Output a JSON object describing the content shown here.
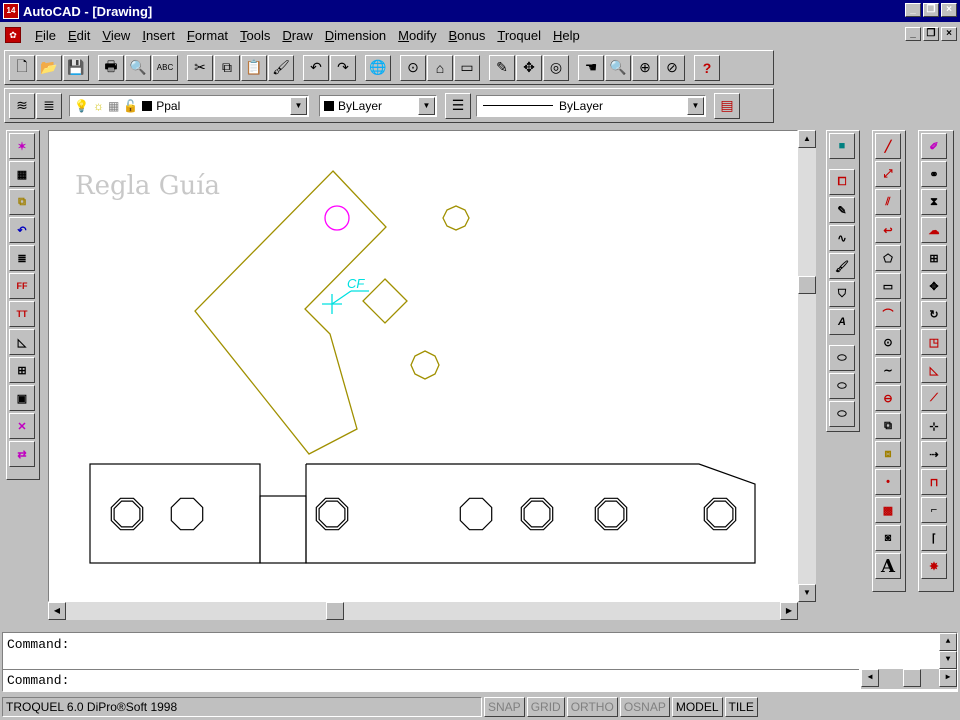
{
  "window": {
    "app_icon_text": "14",
    "title": "AutoCAD - [Drawing]"
  },
  "menu": {
    "items": [
      {
        "label": "File"
      },
      {
        "label": "Edit"
      },
      {
        "label": "View"
      },
      {
        "label": "Insert"
      },
      {
        "label": "Format"
      },
      {
        "label": "Tools"
      },
      {
        "label": "Draw"
      },
      {
        "label": "Dimension"
      },
      {
        "label": "Modify"
      },
      {
        "label": "Bonus"
      },
      {
        "label": "Troquel"
      },
      {
        "label": "Help"
      }
    ]
  },
  "standard_toolbar": {
    "buttons": [
      {
        "icon": "new-icon",
        "glyph": "🗋"
      },
      {
        "icon": "open-icon",
        "glyph": "📂"
      },
      {
        "icon": "save-icon",
        "glyph": "💾"
      },
      {
        "sep": true
      },
      {
        "icon": "print-icon",
        "glyph": "🖶"
      },
      {
        "icon": "print-preview-icon",
        "glyph": "🔍"
      },
      {
        "icon": "spell-check-icon",
        "glyph": "ABC"
      },
      {
        "sep": true
      },
      {
        "icon": "cut-icon",
        "glyph": "✂"
      },
      {
        "icon": "copy-icon",
        "glyph": "⧉"
      },
      {
        "icon": "paste-icon",
        "glyph": "📋"
      },
      {
        "icon": "match-properties-icon",
        "glyph": "🖌"
      },
      {
        "sep": true
      },
      {
        "icon": "undo-icon",
        "glyph": "↶"
      },
      {
        "icon": "redo-icon",
        "glyph": "↷"
      },
      {
        "sep": true
      },
      {
        "icon": "launch-browser-icon",
        "glyph": "🌐"
      },
      {
        "sep": true
      },
      {
        "icon": "object-snap-icon",
        "glyph": "⊙"
      },
      {
        "icon": "ucs-icon",
        "glyph": "⌂"
      },
      {
        "icon": "inquiry-icon",
        "glyph": "▭"
      },
      {
        "sep": true
      },
      {
        "icon": "redraw-icon",
        "glyph": "✎"
      },
      {
        "icon": "pan-icon",
        "glyph": "✥"
      },
      {
        "icon": "aerial-view-icon",
        "glyph": "◎"
      },
      {
        "sep": true
      },
      {
        "icon": "pan-realtime-icon",
        "glyph": "☚"
      },
      {
        "icon": "zoom-realtime-icon",
        "glyph": "🔍"
      },
      {
        "icon": "zoom-window-icon",
        "glyph": "⊕"
      },
      {
        "icon": "zoom-previous-icon",
        "glyph": "⊘"
      },
      {
        "sep": true
      },
      {
        "icon": "help-icon",
        "glyph": "?"
      }
    ]
  },
  "layer_toolbar": {
    "layer_name": "Ppal",
    "color_value": "ByLayer",
    "linetype_value": "ByLayer"
  },
  "drawing": {
    "overlay_text": "Regla Guía",
    "cf_label": "CF",
    "colors": {
      "geometry": "#a09000",
      "magenta": "#ff00ff",
      "cyan": "#00e0e0",
      "black": "#000000"
    }
  },
  "command": {
    "line1": "Command:",
    "line2": "Command:"
  },
  "status": {
    "info": "TROQUEL 6.0 DiPro®Soft 1998",
    "toggles": [
      {
        "label": "SNAP",
        "on": false
      },
      {
        "label": "GRID",
        "on": false
      },
      {
        "label": "ORTHO",
        "on": false
      },
      {
        "label": "OSNAP",
        "on": false
      },
      {
        "label": "MODEL",
        "on": true
      },
      {
        "label": "TILE",
        "on": true
      }
    ]
  }
}
